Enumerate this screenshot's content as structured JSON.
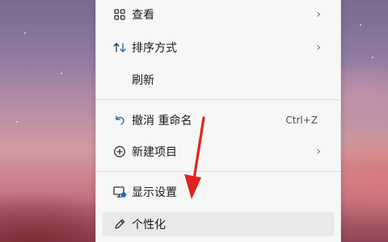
{
  "menu": {
    "items": [
      {
        "label": "查看",
        "icon": "grid-view-icon",
        "submenu": true
      },
      {
        "label": "排序方式",
        "icon": "sort-icon",
        "submenu": true
      },
      {
        "label": "刷新",
        "icon": ""
      },
      {
        "label": "撤消 重命名",
        "icon": "undo-icon",
        "shortcut": "Ctrl+Z"
      },
      {
        "label": "新建项目",
        "icon": "add-circle-icon",
        "submenu": true
      },
      {
        "label": "显示设置",
        "icon": "display-settings-icon"
      },
      {
        "label": "个性化",
        "icon": "pen-icon",
        "highlighted": true
      }
    ]
  },
  "colors": {
    "accent": "#1a6fc2",
    "annotation_arrow": "#e0231c",
    "menu_bg": "#f7f7f7"
  }
}
